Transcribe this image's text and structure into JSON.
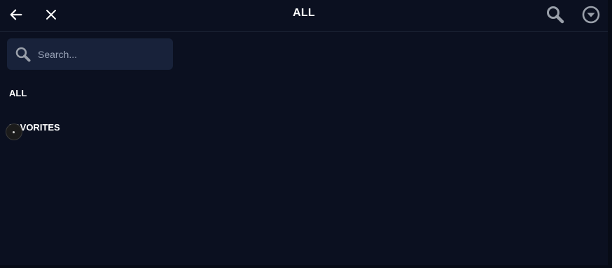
{
  "header": {
    "title": "ALL",
    "back_icon": "arrow-left-icon",
    "close_icon": "close-icon",
    "search_icon": "search-icon",
    "dropdown_icon": "chevron-down-circle-icon"
  },
  "search": {
    "placeholder": "Search...",
    "value": ""
  },
  "categories": [
    {
      "label": "ALL"
    },
    {
      "label": "FAVORITES"
    }
  ],
  "colors": {
    "background": "#0b1020",
    "search_background": "#18223a",
    "text": "#ffffff",
    "icon": "#9aa0aa"
  }
}
